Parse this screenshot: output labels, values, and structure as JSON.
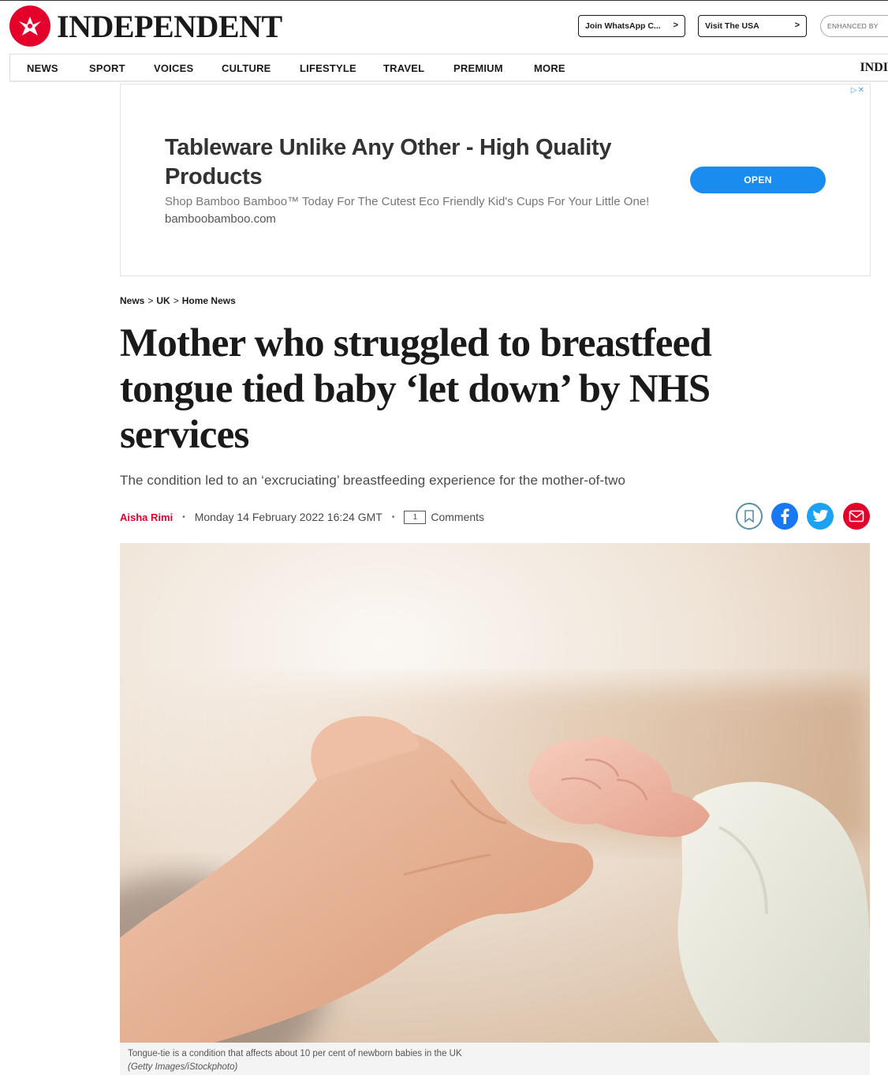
{
  "header": {
    "logo_text": "INDEPENDENT",
    "promo_whatsapp": "Join WhatsApp C...",
    "promo_usa": "Visit The USA",
    "promo_enhanced": "ENHANCED BY",
    "chevron": ">"
  },
  "nav": {
    "items": [
      "NEWS",
      "SPORT",
      "VOICES",
      "CULTURE",
      "LIFESTYLE",
      "TRAVEL",
      "PREMIUM",
      "MORE"
    ],
    "brand_tail": "INDI"
  },
  "ad": {
    "choices": "▷✕",
    "title": "Tableware Unlike Any Other - High Quality Products",
    "body": "Shop Bamboo Bamboo™ Today For The Cutest Eco Friendly Kid's Cups For Your Little One!",
    "domain": "bamboobamboo.com",
    "button": "OPEN"
  },
  "article": {
    "breadcrumb": [
      "News",
      "UK",
      "Home News"
    ],
    "breadcrumb_sep": ">",
    "headline": "Mother who struggled to breastfeed tongue tied baby ‘let down’ by NHS services",
    "standfirst": "The condition led to an ‘excruciating’ breastfeeding experience for the mother-of-two",
    "author": "Aisha Rimi",
    "date": "Monday 14 February 2022 16:24 GMT",
    "comment_count": "1",
    "comments_label": "Comments",
    "caption": "Tongue-tie is a condition that affects about 10 per cent of newborn babies in the UK",
    "credit": "(Getty Images/iStockphoto)"
  },
  "colors": {
    "brand_red": "#e4002b",
    "facebook": "#1877f2",
    "twitter": "#1da1f2",
    "ad_button": "#1a8cf0"
  },
  "icons": [
    "independent-eagle-logo",
    "bookmark-icon",
    "facebook-icon",
    "twitter-icon",
    "mail-icon",
    "comment-icon",
    "adchoices-icon"
  ]
}
